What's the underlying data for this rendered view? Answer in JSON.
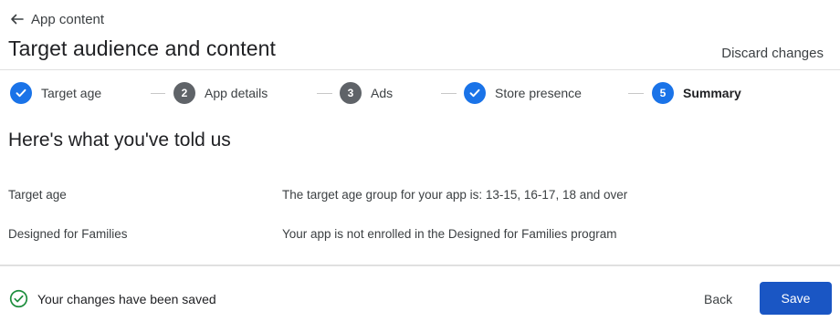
{
  "header": {
    "back_label": "App content",
    "title": "Target audience and content",
    "discard_label": "Discard changes"
  },
  "stepper": {
    "steps": [
      {
        "label": "Target age",
        "status": "done",
        "number": ""
      },
      {
        "label": "App details",
        "status": "todo",
        "number": "2"
      },
      {
        "label": "Ads",
        "status": "todo",
        "number": "3"
      },
      {
        "label": "Store presence",
        "status": "done",
        "number": ""
      },
      {
        "label": "Summary",
        "status": "current",
        "number": "5"
      }
    ]
  },
  "summary": {
    "title": "Here's what you've told us",
    "rows": [
      {
        "label": "Target age",
        "value": "The target age group for your app is: 13-15, 16-17, 18 and over"
      },
      {
        "label": "Designed for Families",
        "value": "Your app is not enrolled in the Designed for Families program"
      }
    ]
  },
  "footer": {
    "saved_text": "Your changes have been saved",
    "back_label": "Back",
    "save_label": "Save"
  },
  "colors": {
    "accent": "#1a73e8",
    "save_button": "#1a56c4",
    "success": "#1e8e3e"
  },
  "icons": {
    "back": "arrow-left-icon",
    "done_step": "check-icon",
    "saved": "check-circle-icon"
  }
}
